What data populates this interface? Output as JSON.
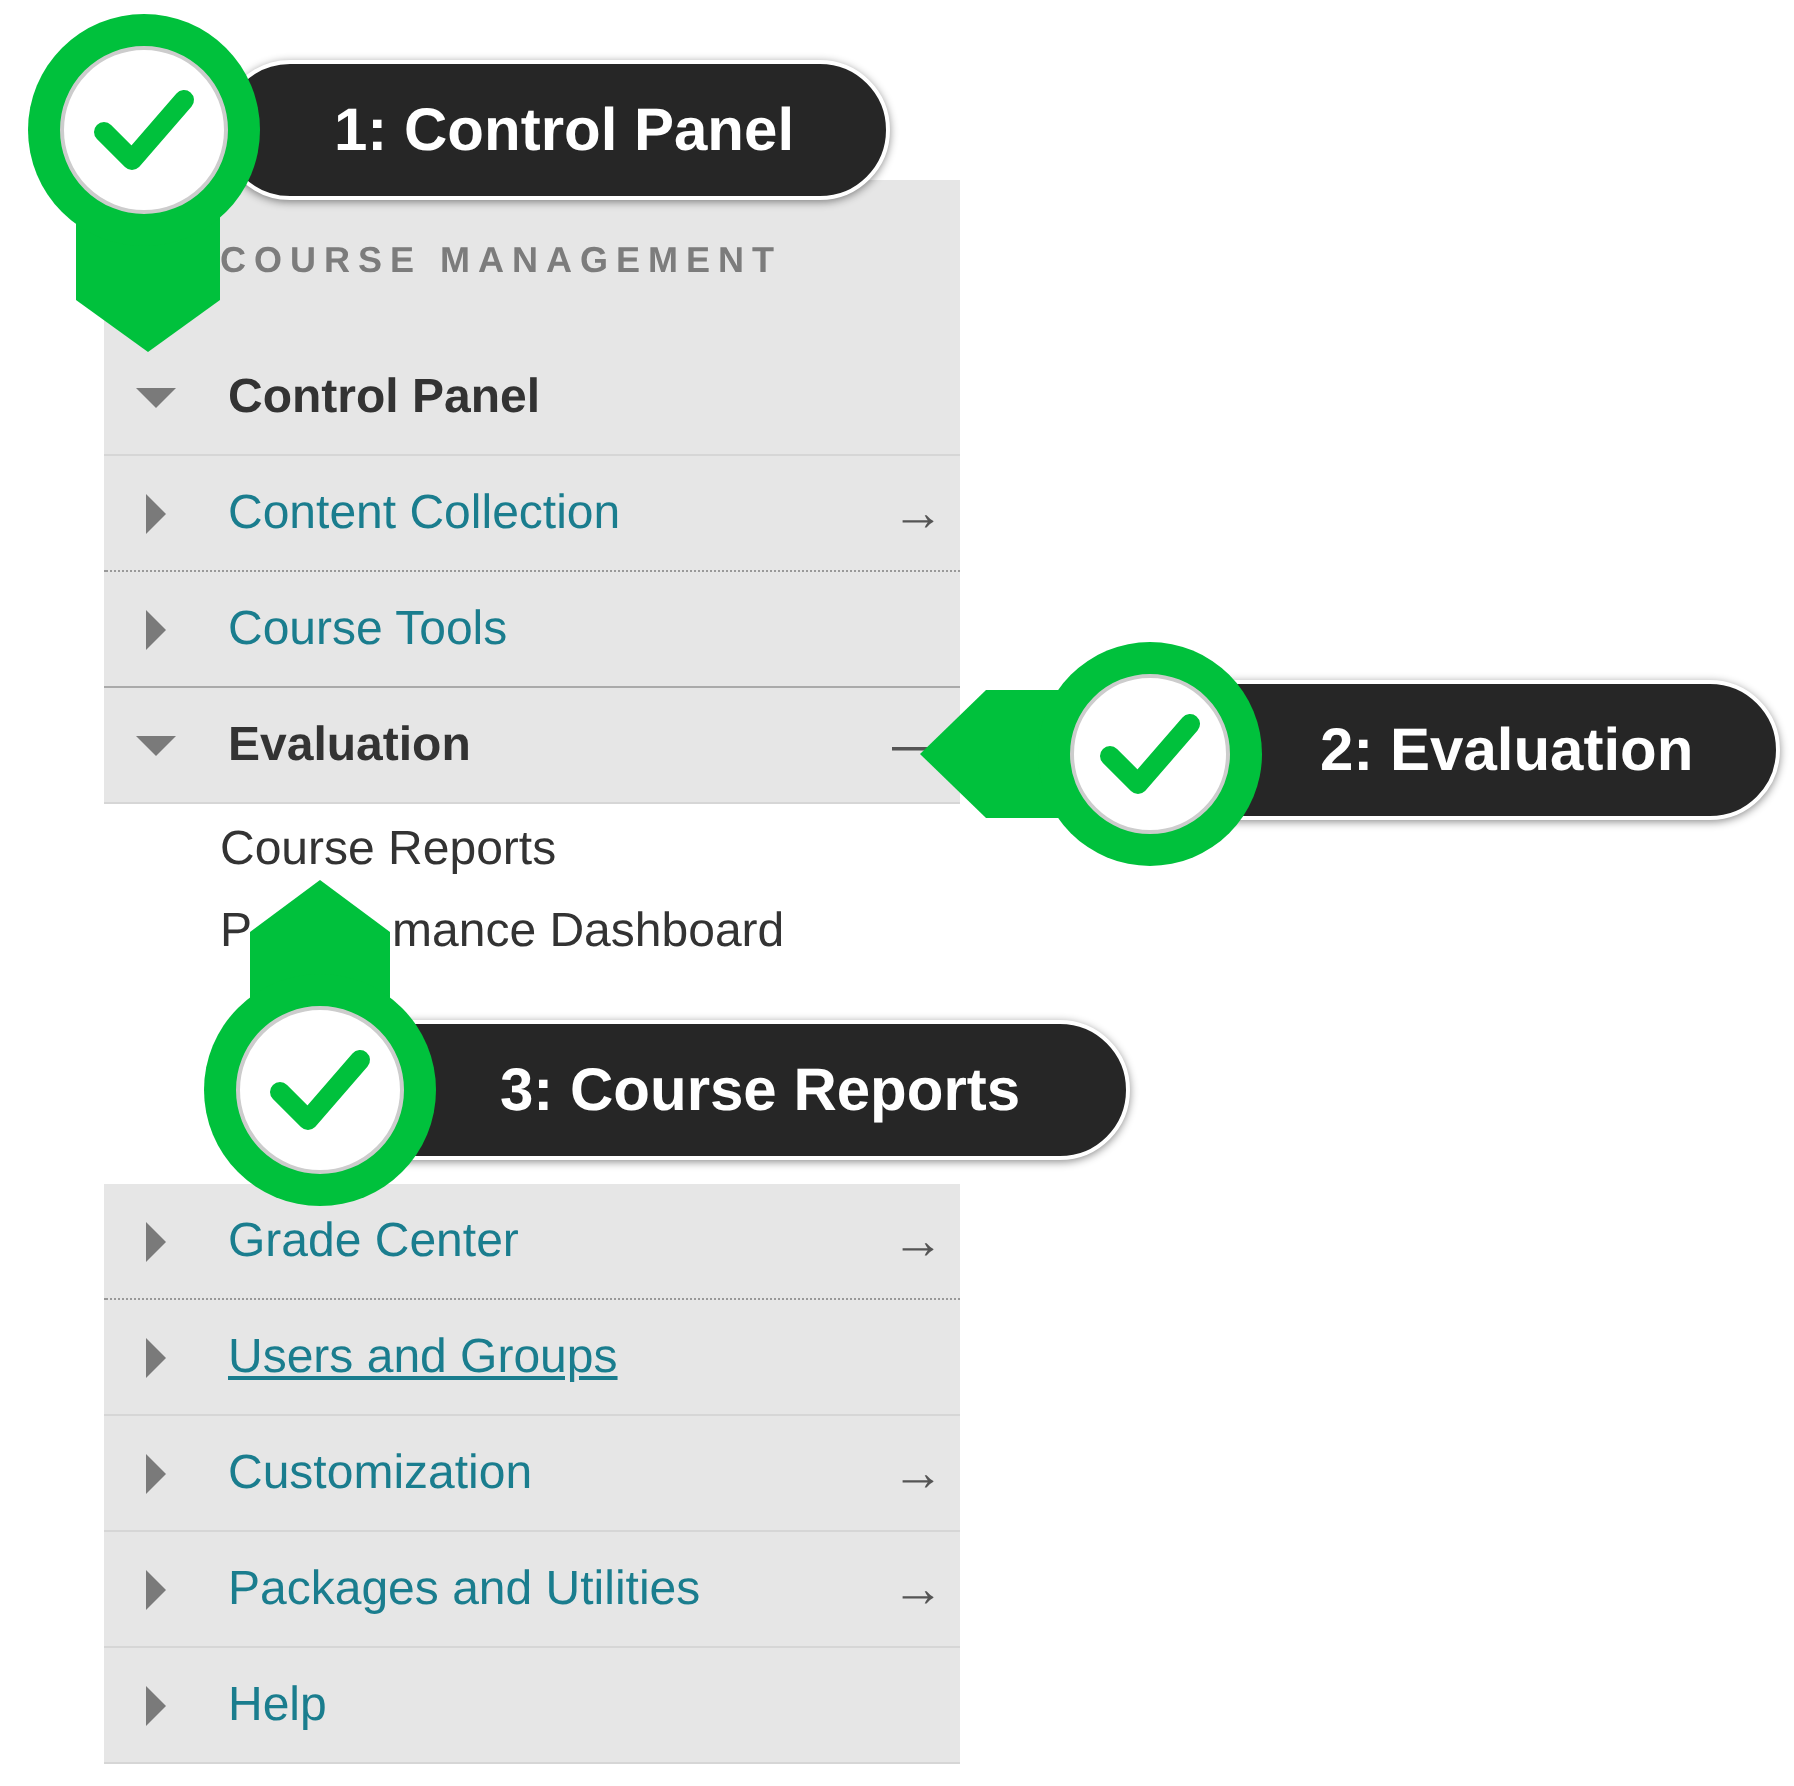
{
  "menu": {
    "header": "COURSE MANAGEMENT",
    "root": {
      "label": "Control Panel",
      "expanded": true,
      "children": [
        {
          "label": "Content Collection",
          "expanded": false,
          "hovered": false,
          "side_mark": "→"
        },
        {
          "label": "Course Tools",
          "expanded": false,
          "hovered": false
        },
        {
          "label": "Evaluation",
          "expanded": true,
          "hovered": false,
          "side_mark": "—",
          "children": [
            {
              "label": "Course Reports"
            },
            {
              "label": "P",
              "label_end": "mance Dashboard"
            }
          ]
        },
        {
          "label": "Grade Center",
          "expanded": false,
          "hovered": false,
          "side_mark": "→"
        },
        {
          "label": "Users and Groups",
          "expanded": false,
          "hovered": true
        },
        {
          "label": "Customization",
          "expanded": false,
          "hovered": false,
          "side_mark": "→"
        },
        {
          "label": "Packages and Utilities",
          "expanded": false,
          "hovered": false,
          "side_mark": "→"
        },
        {
          "label": "Help",
          "expanded": false,
          "hovered": false
        }
      ]
    }
  },
  "callouts": [
    {
      "label": "1: Control Panel",
      "kind": "down"
    },
    {
      "label": "2: Evaluation",
      "kind": "left"
    },
    {
      "label": "3: Course Reports",
      "kind": "up"
    }
  ]
}
